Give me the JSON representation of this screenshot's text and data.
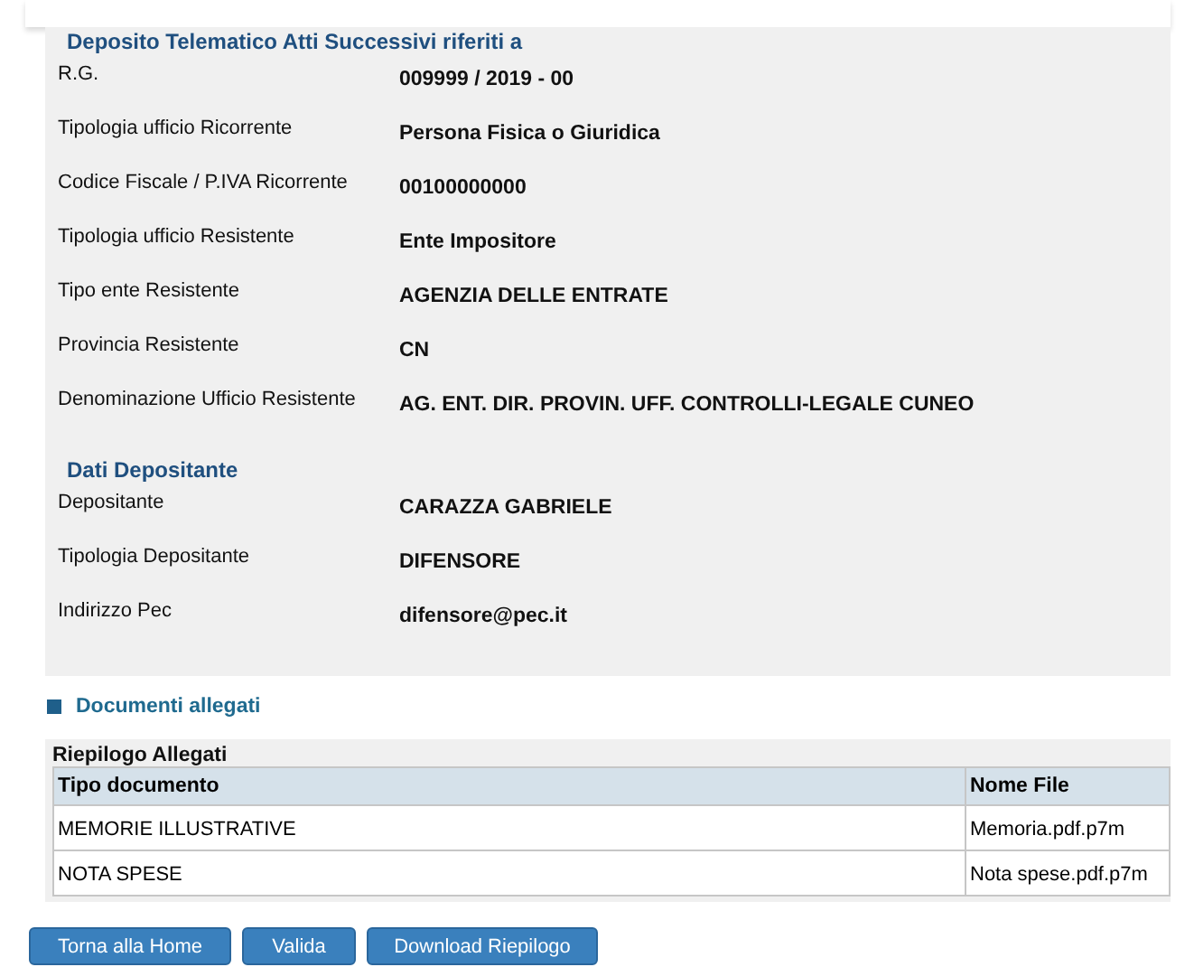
{
  "sections": [
    {
      "title": "Deposito Telematico Atti Successivi riferiti a",
      "fields": [
        {
          "label": "R.G.",
          "value": "009999 / 2019 - 00"
        },
        {
          "label": "Tipologia ufficio Ricorrente",
          "value": "Persona Fisica o Giuridica"
        },
        {
          "label": "Codice Fiscale / P.IVA Ricorrente",
          "value": "00100000000"
        },
        {
          "label": "Tipologia ufficio Resistente",
          "value": "Ente Impositore"
        },
        {
          "label": "Tipo ente Resistente",
          "value": "AGENZIA DELLE ENTRATE"
        },
        {
          "label": "Provincia Resistente",
          "value": "CN"
        },
        {
          "label": "Denominazione Ufficio Resistente",
          "value": "AG. ENT. DIR. PROVIN. UFF. CONTROLLI-LEGALE CUNEO"
        }
      ]
    },
    {
      "title": "Dati Depositante",
      "fields": [
        {
          "label": "Depositante",
          "value": "CARAZZA GABRIELE"
        },
        {
          "label": "Tipologia Depositante",
          "value": "DIFENSORE"
        },
        {
          "label": "Indirizzo Pec",
          "value": "difensore@pec.it"
        }
      ]
    }
  ],
  "documents": {
    "heading": "Documenti allegati",
    "table_title": "Riepilogo Allegati",
    "columns": [
      "Tipo documento",
      "Nome File"
    ],
    "rows": [
      [
        "MEMORIE ILLUSTRATIVE",
        "Memoria.pdf.p7m"
      ],
      [
        "NOTA SPESE",
        "Nota spese.pdf.p7m"
      ]
    ]
  },
  "buttons": [
    "Torna alla Home",
    "Valida",
    "Download Riepilogo"
  ]
}
